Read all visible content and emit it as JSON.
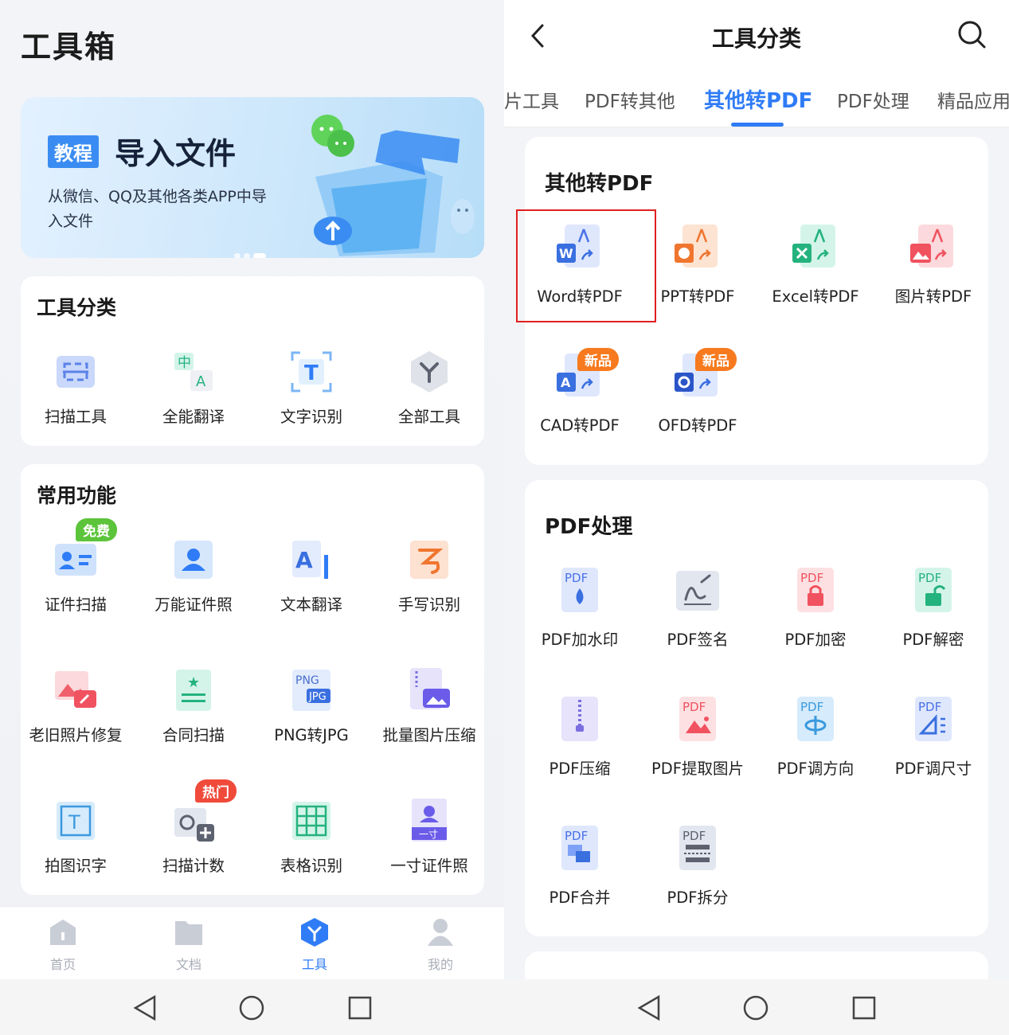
{
  "left": {
    "page_title": "工具箱",
    "banner": {
      "tag": "教程",
      "heading": "导入文件",
      "subtitle": "从微信、QQ及其他各类APP中导入文件",
      "icons": [
        "wechat-icon",
        "folder-import-icon",
        "cloud-upload-icon",
        "qq-icon"
      ]
    },
    "tool_categories": {
      "title": "工具分类",
      "items": [
        {
          "label": "扫描工具",
          "icon": "scan-icon"
        },
        {
          "label": "全能翻译",
          "icon": "translate-icon"
        },
        {
          "label": "文字识别",
          "icon": "text-recognition-icon"
        },
        {
          "label": "全部工具",
          "icon": "all-tools-icon"
        }
      ]
    },
    "common_functions": {
      "title": "常用功能",
      "items": [
        {
          "label": "证件扫描",
          "icon": "id-card-scan-icon",
          "badge": "免费"
        },
        {
          "label": "万能证件照",
          "icon": "id-photo-icon"
        },
        {
          "label": "文本翻译",
          "icon": "text-translate-icon"
        },
        {
          "label": "手写识别",
          "icon": "handwriting-icon"
        },
        {
          "label": "老旧照片修复",
          "icon": "photo-repair-icon"
        },
        {
          "label": "合同扫描",
          "icon": "contract-scan-icon"
        },
        {
          "label": "PNG转JPG",
          "icon": "png-to-jpg-icon"
        },
        {
          "label": "批量图片压缩",
          "icon": "image-compress-icon"
        },
        {
          "label": "拍图识字",
          "icon": "photo-ocr-icon"
        },
        {
          "label": "扫描计数",
          "icon": "scan-count-icon",
          "badge": "热门"
        },
        {
          "label": "表格识别",
          "icon": "table-recognition-icon"
        },
        {
          "label": "一寸证件照",
          "icon": "one-inch-photo-icon"
        }
      ],
      "png_icon_text": [
        "PNG",
        "JPG"
      ],
      "one_inch_text": "一寸"
    },
    "bottom_nav": [
      {
        "label": "首页",
        "icon": "home-icon",
        "active": false
      },
      {
        "label": "文档",
        "icon": "folder-icon",
        "active": false
      },
      {
        "label": "工具",
        "icon": "tools-icon",
        "active": true
      },
      {
        "label": "我的",
        "icon": "profile-icon",
        "active": false
      }
    ]
  },
  "right": {
    "header_title": "工具分类",
    "tabs": [
      "片工具",
      "PDF转其他",
      "其他转PDF",
      "PDF处理",
      "精品应用"
    ],
    "active_tab": "其他转PDF",
    "section_convert": {
      "title": "其他转PDF",
      "items": [
        {
          "label": "Word转PDF",
          "icon": "word-to-pdf-icon",
          "highlighted": true
        },
        {
          "label": "PPT转PDF",
          "icon": "ppt-to-pdf-icon"
        },
        {
          "label": "Excel转PDF",
          "icon": "excel-to-pdf-icon"
        },
        {
          "label": "图片转PDF",
          "icon": "image-to-pdf-icon"
        },
        {
          "label": "CAD转PDF",
          "icon": "cad-to-pdf-icon",
          "badge": "新品"
        },
        {
          "label": "OFD转PDF",
          "icon": "ofd-to-pdf-icon",
          "badge": "新品"
        }
      ]
    },
    "section_process": {
      "title": "PDF处理",
      "items": [
        {
          "label": "PDF加水印",
          "icon": "pdf-watermark-icon"
        },
        {
          "label": "PDF签名",
          "icon": "pdf-signature-icon"
        },
        {
          "label": "PDF加密",
          "icon": "pdf-encrypt-icon"
        },
        {
          "label": "PDF解密",
          "icon": "pdf-decrypt-icon"
        },
        {
          "label": "PDF压缩",
          "icon": "pdf-compress-icon"
        },
        {
          "label": "PDF提取图片",
          "icon": "pdf-extract-image-icon"
        },
        {
          "label": "PDF调方向",
          "icon": "pdf-rotate-icon"
        },
        {
          "label": "PDF调尺寸",
          "icon": "pdf-resize-icon"
        },
        {
          "label": "PDF合并",
          "icon": "pdf-merge-icon"
        },
        {
          "label": "PDF拆分",
          "icon": "pdf-split-icon"
        }
      ],
      "pdf_tag": "PDF"
    }
  },
  "colors": {
    "accent": "#2f7cf6",
    "badge_free": "#5cc43a",
    "badge_hot": "#f04a3a",
    "badge_new": "#f77a1f",
    "highlight_box": "#e02020"
  }
}
